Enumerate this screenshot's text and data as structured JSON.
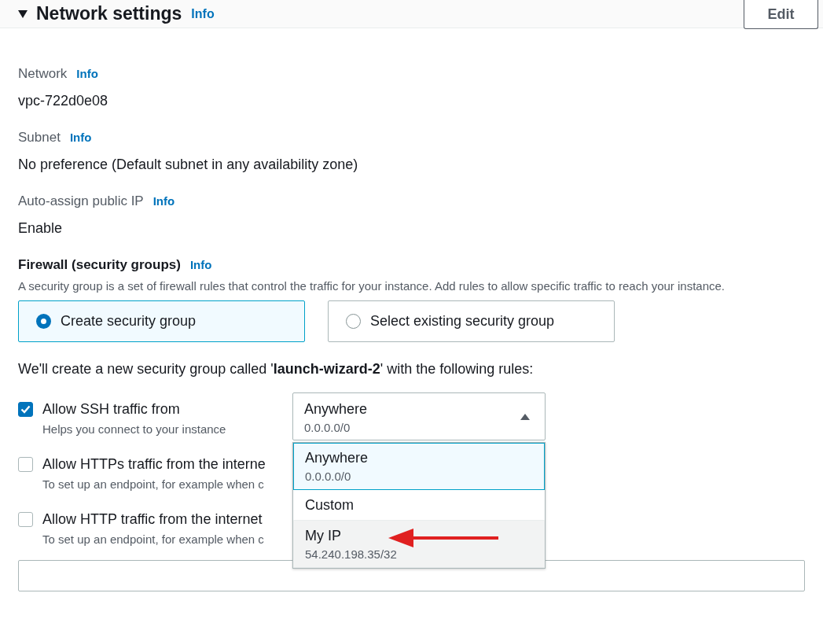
{
  "section": {
    "title": "Network settings",
    "info": "Info",
    "expanded": true,
    "edit_button": "Edit"
  },
  "fields": [
    {
      "label": "Network",
      "info": "Info",
      "value": "vpc-722d0e08"
    },
    {
      "label": "Subnet",
      "info": "Info",
      "value": "No preference (Default subnet in any availability zone)"
    },
    {
      "label": "Auto-assign public IP",
      "info": "Info",
      "value": "Enable"
    }
  ],
  "firewall": {
    "label": "Firewall (security groups)",
    "info": "Info",
    "description": "A security group is a set of firewall rules that control the traffic for your instance. Add rules to allow specific traffic to reach your instance.",
    "options": [
      {
        "label": "Create security group",
        "selected": true
      },
      {
        "label": "Select existing security group",
        "selected": false
      }
    ],
    "note": "We'll create a new security group called '**launch-wizard-2**' with the following rules:"
  },
  "rules": [
    {
      "label": "Allow SSH traffic from",
      "hint": "Helps you connect to your instance",
      "checked": true
    },
    {
      "label": "Allow HTTPs traffic from the interne",
      "hint": "To set up an endpoint, for example when c",
      "checked": false
    },
    {
      "label": "Allow HTTP traffic from the internet",
      "hint": "To set up an endpoint, for example when c",
      "checked": false
    }
  ],
  "source_select": {
    "value": "Anywhere",
    "detail": "0.0.0.0/0",
    "expanded": true,
    "options": [
      {
        "label": "Anywhere",
        "detail": "0.0.0.0/0",
        "selected": true,
        "hovered": false
      },
      {
        "label": "Custom",
        "selected": false,
        "hovered": false
      },
      {
        "label": "My IP",
        "detail": "54.240.198.35/32",
        "selected": false,
        "hovered": true
      }
    ]
  }
}
